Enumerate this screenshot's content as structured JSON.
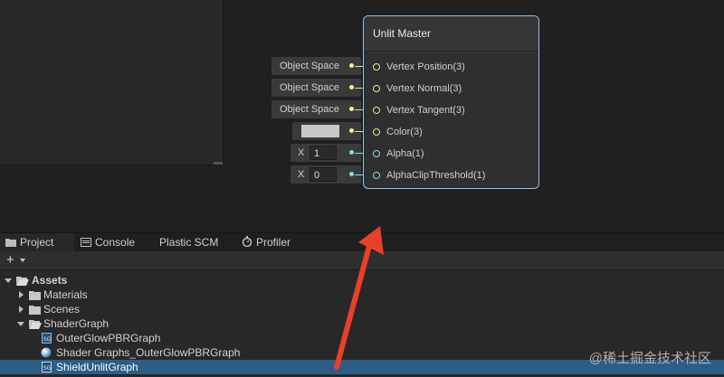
{
  "master_node": {
    "title": "Unlit Master",
    "ports": [
      {
        "label": "Vertex Position(3)",
        "kind": "vector"
      },
      {
        "label": "Vertex Normal(3)",
        "kind": "vector"
      },
      {
        "label": "Vertex Tangent(3)",
        "kind": "vector"
      },
      {
        "label": "Color(3)",
        "kind": "vector"
      },
      {
        "label": "Alpha(1)",
        "kind": "float"
      },
      {
        "label": "AlphaClipThreshold(1)",
        "kind": "float"
      }
    ]
  },
  "inputs": {
    "space_position": "Object Space",
    "space_normal": "Object Space",
    "space_tangent": "Object Space",
    "color_value": "#c8c8c8",
    "alpha_axis": "X",
    "alpha_value": "1",
    "clip_axis": "X",
    "clip_value": "0"
  },
  "tabs": [
    {
      "label": "Project",
      "icon": "folder-icon"
    },
    {
      "label": "Console",
      "icon": "console-icon"
    },
    {
      "label": "Plastic SCM",
      "icon": ""
    },
    {
      "label": "Profiler",
      "icon": "profiler-icon"
    }
  ],
  "toolbar": {
    "add_label": "+"
  },
  "tree": [
    {
      "label": "Assets",
      "type": "folder-open",
      "expanded": true,
      "bold": true
    },
    {
      "label": "Materials",
      "type": "folder",
      "expanded": false
    },
    {
      "label": "Scenes",
      "type": "folder",
      "expanded": false
    },
    {
      "label": "ShaderGraph",
      "type": "folder-open",
      "expanded": true
    },
    {
      "label": "OuterGlowPBRGraph",
      "type": "shadergraph"
    },
    {
      "label": "Shader Graphs_OuterGlowPBRGraph",
      "type": "shader"
    },
    {
      "label": "ShieldUnlitGraph",
      "type": "shadergraph",
      "selected": true
    }
  ],
  "watermark": "@稀土掘金技术社区",
  "colors": {
    "selection": "#2c5d87",
    "node_border": "#8fc0e8",
    "annotation": "#e8402a"
  }
}
